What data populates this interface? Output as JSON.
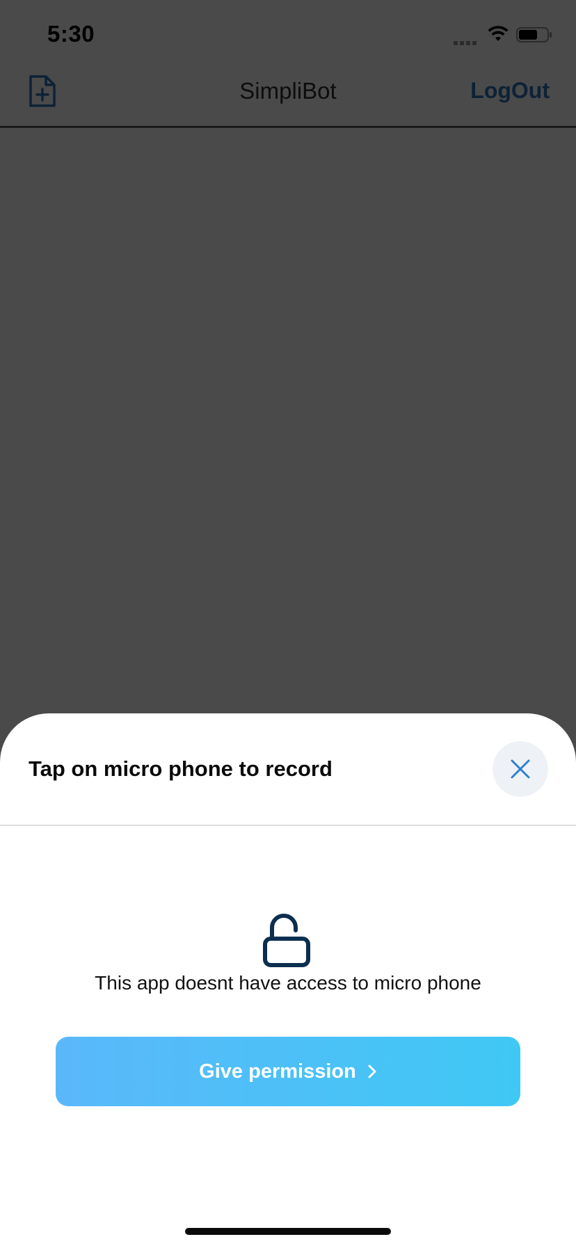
{
  "status_bar": {
    "time": "5:30",
    "icons": [
      "cellular-signal-icon",
      "wifi-icon",
      "battery-icon"
    ]
  },
  "nav": {
    "title": "SimpliBot",
    "logout_label": "LogOut",
    "add_icon": "file-plus-icon"
  },
  "sheet": {
    "title": "Tap on micro phone to record",
    "close_icon": "close-icon",
    "lock_icon": "unlock-icon",
    "message": "This app doesnt have access to micro phone",
    "button_label": "Give permission",
    "button_icon": "chevron-right-icon"
  },
  "colors": {
    "overlay_bg": "#4a4a4a",
    "primary_dark": "#0d2236",
    "button_gradient_start": "#5ab8fa",
    "button_gradient_end": "#40c8f4",
    "close_accent": "#2d7fd3"
  }
}
